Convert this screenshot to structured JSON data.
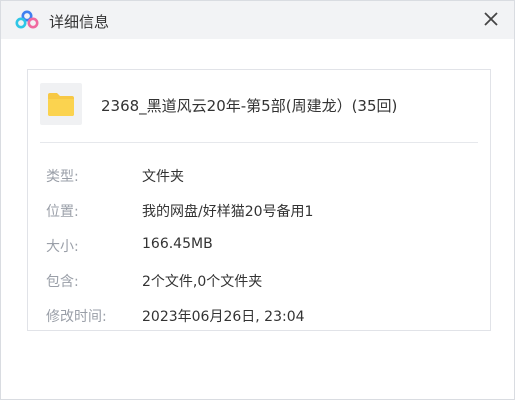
{
  "window": {
    "title": "详细信息",
    "close_symbol": "×",
    "app_icon": "cloud-logo-icon",
    "accent_colors": {
      "blue": "#3f7ff0",
      "pink": "#f06aa0",
      "cyan": "#2fc6e6"
    }
  },
  "file": {
    "icon": "folder-icon",
    "icon_color": "#f7c844",
    "name": "2368_黑道风云20年-第5部(周建龙）(35回)"
  },
  "details": [
    {
      "label": "类型:",
      "value": "文件夹"
    },
    {
      "label": "位置:",
      "value": "我的网盘/好样猫20号备用1"
    },
    {
      "label": "大小:",
      "value": "166.45MB"
    },
    {
      "label": "包含:",
      "value": "2个文件,0个文件夹"
    },
    {
      "label": "修改时间:",
      "value": "2023年06月26日, 23:04"
    }
  ]
}
